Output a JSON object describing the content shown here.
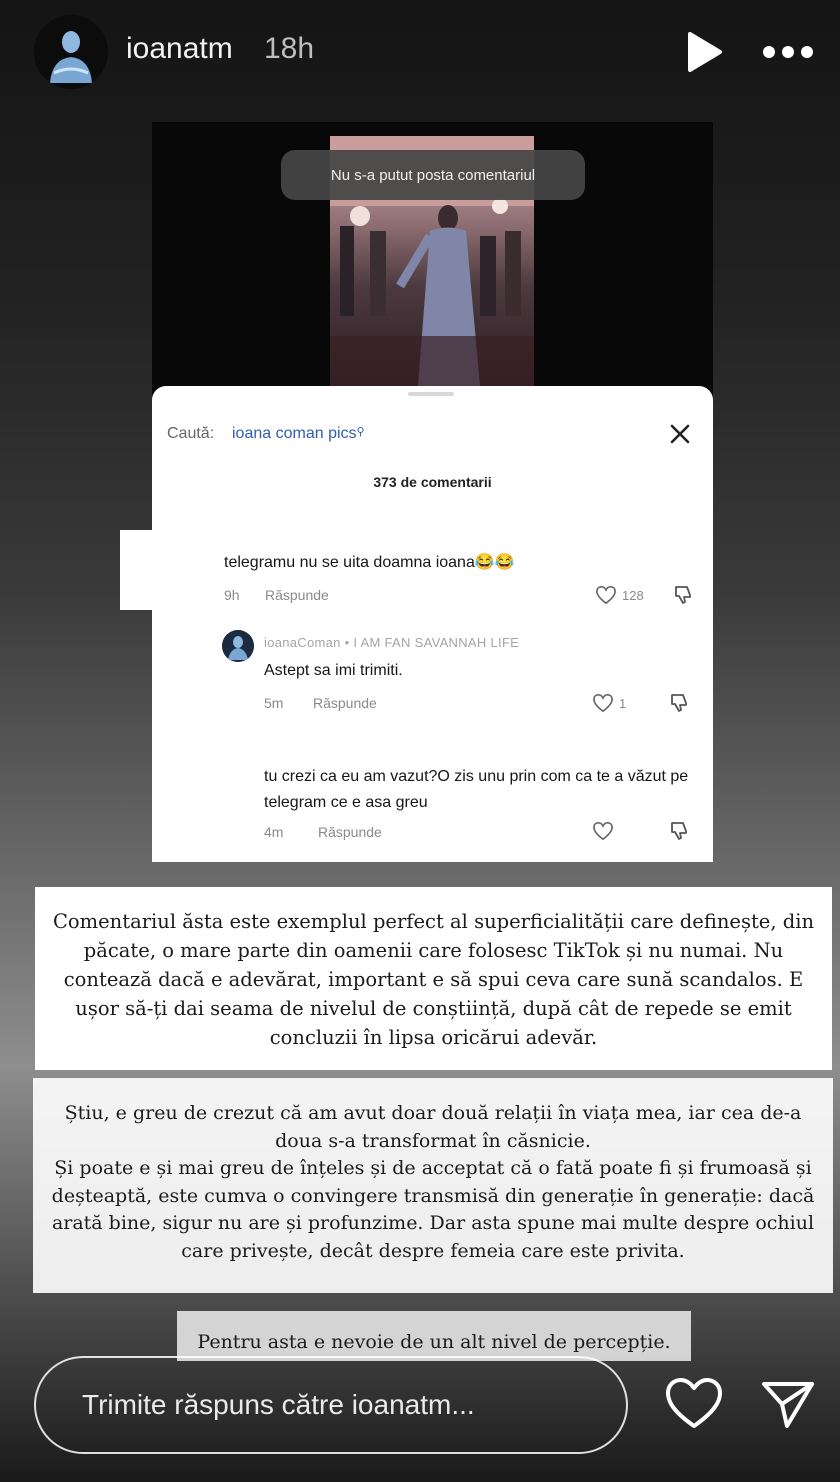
{
  "header": {
    "username": "ioanatm",
    "time": "18h"
  },
  "embedded": {
    "toast": "Nu s-a putut posta comentariul",
    "search_label": "Caută:",
    "search_term": "ioana coman pics",
    "comment_count": "373 de comentarii",
    "comments": [
      {
        "text": "telegramu nu se uita doamna ioana😂😂",
        "time": "9h",
        "reply": "Răspunde",
        "likes": "128"
      },
      {
        "author": "ioanaComan • I AM FAN SAVANNAH LIFE",
        "text": "Astept sa imi trimiti.",
        "time": "5m",
        "reply": "Răspunde",
        "likes": "1"
      },
      {
        "text": "tu crezi ca eu am vazut?O zis unu prin com ca te a văzut pe telegram ce e asa greu",
        "time": "4m",
        "reply": "Răspunde"
      }
    ]
  },
  "text_boxes": {
    "box1": "Comentariul ăsta este exemplul perfect al superficialității care definește, din păcate, o mare parte din oamenii care folosesc TikTok și nu numai. Nu contează dacă e adevărat, important e să spui ceva care sună scandalos. E ușor să-ți dai seama de nivelul de conștiință, după cât de repede se emit concluzii în lipsa oricărui adevăr.",
    "box2_line1": "Știu, e greu de crezut că am avut doar două relații în viața mea, iar cea de-a doua s-a transformat în căsnicie.",
    "box2_line2": "Și poate e și mai greu de înțeles și de acceptat că o fată poate fi și frumoasă și deșteaptă, este cumva o convingere transmisă din generație în generație: dacă arată bine, sigur nu are și profunzime. Dar asta spune mai multe despre ochiul care privește, decât despre femeia care este privita.",
    "box3": "Pentru asta e nevoie de un alt nivel de percepție."
  },
  "footer": {
    "reply_placeholder": "Trimite răspuns către ioanatm..."
  }
}
